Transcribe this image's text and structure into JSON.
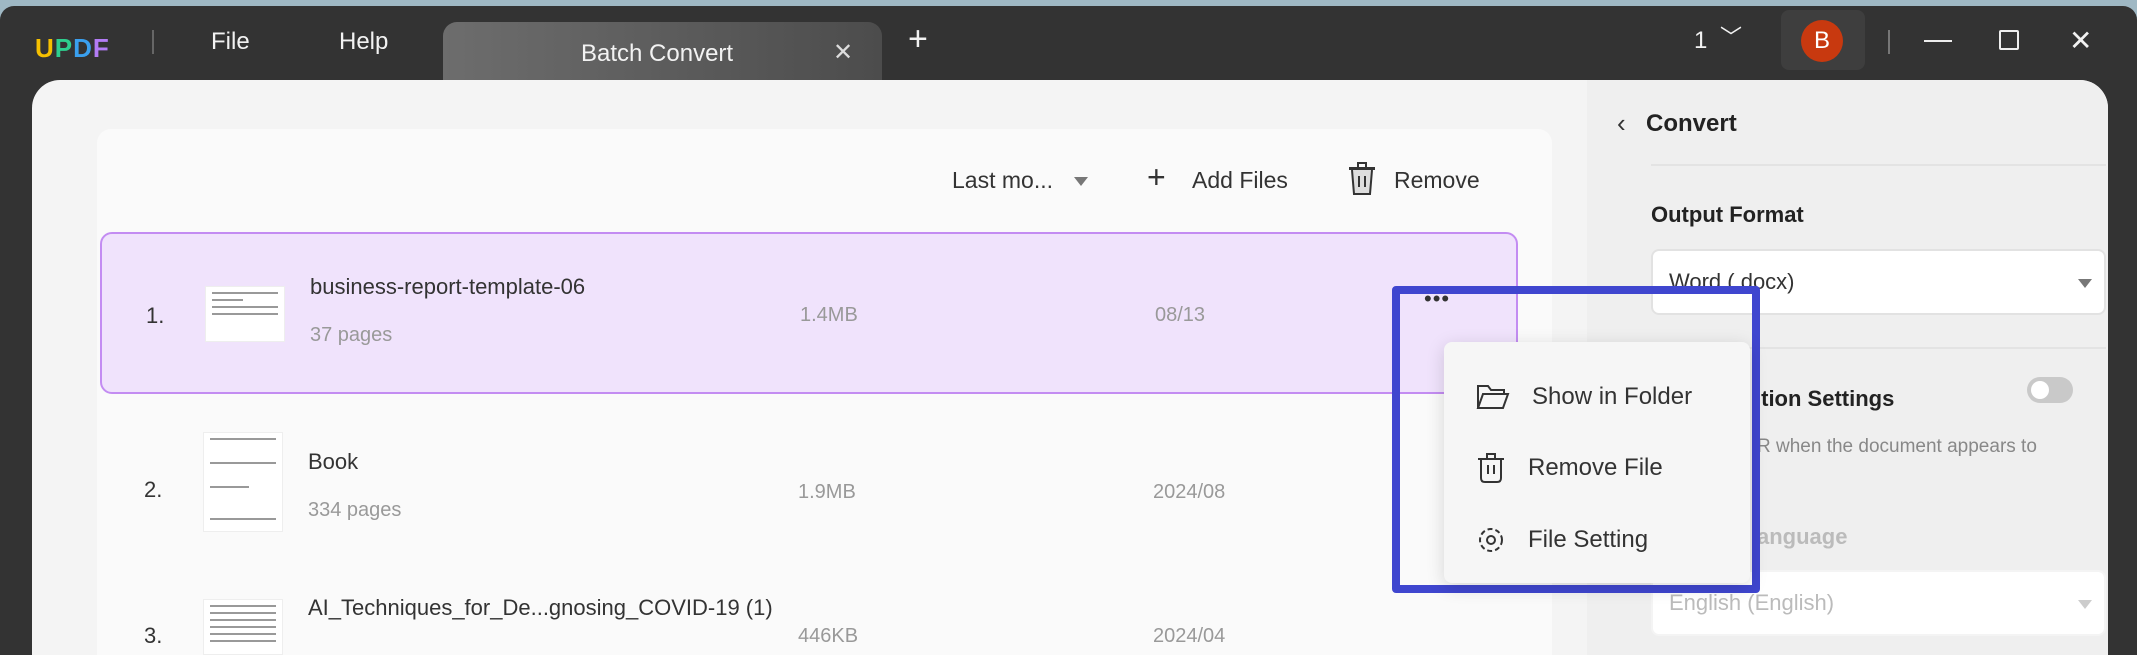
{
  "titlebar": {
    "logo": "UPDF",
    "menu": [
      "File",
      "Help"
    ],
    "tab_title": "Batch Convert",
    "page_count": "1",
    "avatar_initial": "B"
  },
  "toolbar": {
    "sort_label": "Last mo...",
    "add_files": "Add Files",
    "remove": "Remove"
  },
  "files": [
    {
      "index": "1.",
      "name": "business-report-template-06",
      "pages": "37 pages",
      "size": "1.4MB",
      "date": "08/13"
    },
    {
      "index": "2.",
      "name": "Book",
      "pages": "334 pages",
      "size": "1.9MB",
      "date": "2024/08"
    },
    {
      "index": "3.",
      "name": "AI_Techniques_for_De...gnosing_COVID-19 (1)",
      "pages": "",
      "size": "446KB",
      "date": "2024/04"
    }
  ],
  "context_menu": {
    "items": [
      {
        "label": "Show in Folder",
        "icon": "folder-icon"
      },
      {
        "label": "Remove File",
        "icon": "trash-icon"
      },
      {
        "label": "File Setting",
        "icon": "gear-icon"
      }
    ]
  },
  "panel": {
    "title": "Convert",
    "output_format_label": "Output Format",
    "output_format_value": "Word (.docx)",
    "ocr_label_partial": "ition Settings",
    "ocr_desc_partial": "R when the document appears to",
    "language_label_partial": "anguage",
    "language_value": "English (English)",
    "ocr_enabled": false
  },
  "colors": {
    "accent": "#c38cf2",
    "highlight": "#3f46cf",
    "avatar": "#c8390f"
  }
}
